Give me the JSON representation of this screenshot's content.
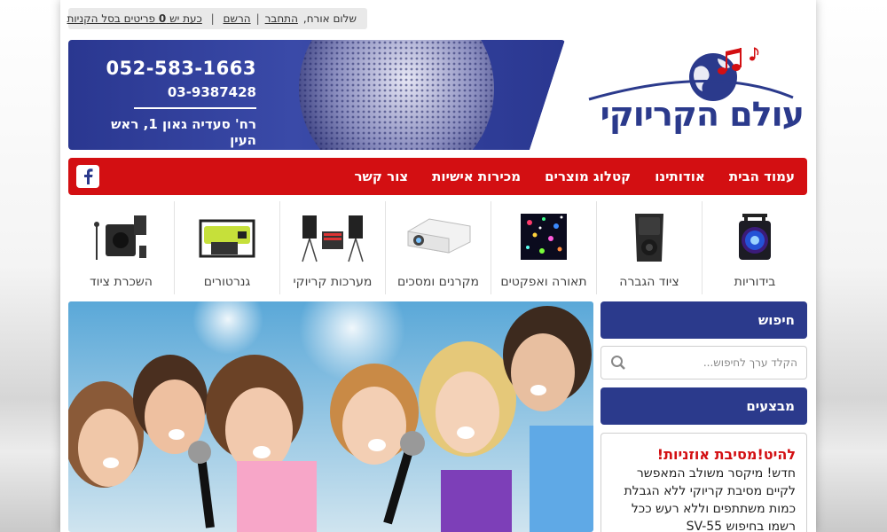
{
  "userbar": {
    "greeting": "שלום אורח,",
    "login": "התחבר",
    "register": "הרשם",
    "cart_prefix": "כעת יש",
    "cart_count": "0",
    "cart_suffix": "פריטים בסל הקניות"
  },
  "logo": {
    "text": "עולם הקריוקי"
  },
  "banner": {
    "phone1": "052-583-1663",
    "phone2": "03-9387428",
    "address": "רח' סעדיה גאון 1, ראש העין"
  },
  "nav": {
    "items": [
      "עמוד הבית",
      "אודותינו",
      "קטלוג מוצרים",
      "מכירות אישיות",
      "צור קשר"
    ]
  },
  "categories": [
    {
      "label": "בידוריות",
      "icon": "speaker-trolley-icon"
    },
    {
      "label": "ציוד הגברה",
      "icon": "pa-speaker-icon"
    },
    {
      "label": "תאורה ואפקטים",
      "icon": "disco-light-icon"
    },
    {
      "label": "מקרנים ומסכים",
      "icon": "projector-icon"
    },
    {
      "label": "מערכות קריוקי",
      "icon": "karaoke-system-icon"
    },
    {
      "label": "גנרטורים",
      "icon": "generator-icon"
    },
    {
      "label": "השכרת ציוד",
      "icon": "rental-equipment-icon"
    }
  ],
  "sidebar": {
    "search_title": "חיפוש",
    "search_placeholder": "הקלד ערך לחיפוש...",
    "deals_title": "מבצעים",
    "promo_title": "להיט!מסיבת אוזניות!",
    "promo_body": "חדש! מיקסר משולב המאפשר לקיים מסיבת קריוקי ללא הגבלת כמות משתתפים וללא רעש ככל רשמו בחיפוש SV-55"
  },
  "colors": {
    "brand_blue": "#2b3a8c",
    "nav_red": "#d30f12"
  }
}
